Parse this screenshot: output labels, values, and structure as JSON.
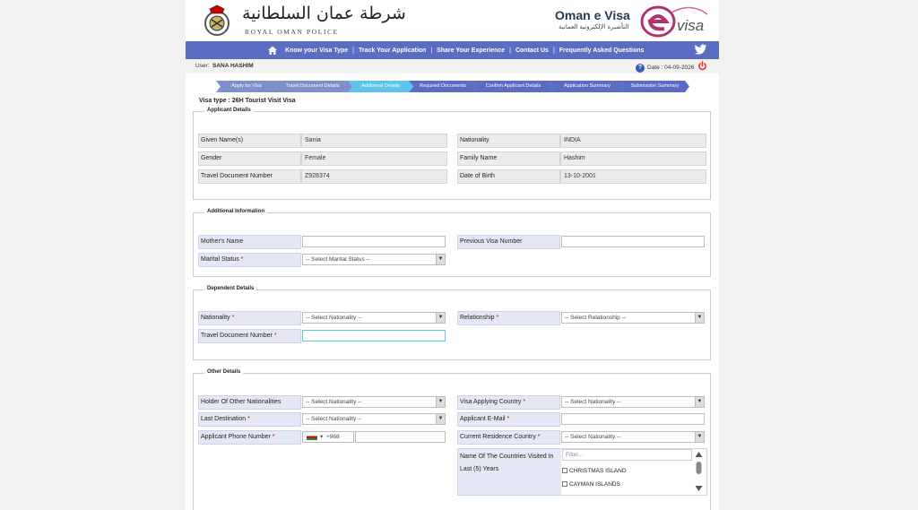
{
  "header": {
    "logo_alt": "Royal Oman Police emblem",
    "title_ar": "شرطة عمان السلطانية",
    "title_en": "ROYAL OMAN POLICE",
    "evisa_en": "Oman e Visa",
    "evisa_ar": "التأشيرة الإلكترونية العمانية",
    "evisa_logo_text": "visa"
  },
  "nav": {
    "items": [
      {
        "label": "Know your Visa Type"
      },
      {
        "label": "Track Your Application"
      },
      {
        "label": "Share Your Experience"
      },
      {
        "label": "Contact Us"
      },
      {
        "label": "Frequently Asked Questions"
      }
    ]
  },
  "userbar": {
    "label": "User:",
    "name": "SANA HASHIM",
    "date_label": "Date :",
    "date_value": "04-09-2026"
  },
  "steps": [
    {
      "label": "Apply for Visa",
      "state": "done"
    },
    {
      "label": "Travel Document Details",
      "state": "done"
    },
    {
      "label": "Additional Details",
      "state": "active"
    },
    {
      "label": "Required Documents",
      "state": "todo"
    },
    {
      "label": "Confirm Applicant Details",
      "state": "todo"
    },
    {
      "label": "Application Summary",
      "state": "todo"
    },
    {
      "label": "Submission Summary",
      "state": "todo"
    }
  ],
  "visa_type": "Visa type  : 26H Tourist Visit Visa",
  "applicant": {
    "legend": "Applicant Details",
    "given_name_label": "Given Name(s)",
    "given_name": "Sania",
    "nationality_label": "Nationality",
    "nationality": "INDIA",
    "gender_label": "Gender",
    "gender": "Female",
    "family_name_label": "Family Name",
    "family_name": "Hashim",
    "travel_doc_label": "Travel Document Number",
    "travel_doc": "Z928374",
    "dob_label": "Date of Birth",
    "dob": "13-10-2001"
  },
  "additional": {
    "legend": "Additional Information",
    "mother_label": "Mother's Name",
    "prev_visa_label": "Previous Visa Number",
    "marital_label": "Marital Status",
    "marital_value": "-- Select Marital Status --"
  },
  "dependent": {
    "legend": "Dependent Details",
    "nationality_label": "Nationality",
    "nationality_value": "-- Select Nationality --",
    "relationship_label": "Relationship",
    "relationship_value": "-- Select Relationship --",
    "travel_doc_label": "Travel Document Number"
  },
  "other": {
    "legend": "Other Details",
    "holder_label": "Holder Of Other Nationalities",
    "holder_value": "-- Select Nationality --",
    "applying_country_label": "Visa Applying Country",
    "applying_country_value": "-- Select Nationality --",
    "last_dest_label": "Last Destination",
    "last_dest_value": "-- Select Nationality --",
    "email_label": "Applicant E-Mail",
    "phone_label": "Applicant Phone Number",
    "phone_code": "+968",
    "residence_label": "Current Residence Country",
    "residence_value": "-- Select Nationality --",
    "visited_label": "Name Of The Countries Visited In Last (5) Years",
    "filter_placeholder": "Filter...",
    "visited_options": [
      "CHRISTMAS ISLAND",
      "CAYMAN ISLANDS"
    ]
  },
  "colors": {
    "navbar": "#5b6cc3",
    "step_active": "#5ec4ea",
    "label_bg": "#e5e8f4"
  }
}
